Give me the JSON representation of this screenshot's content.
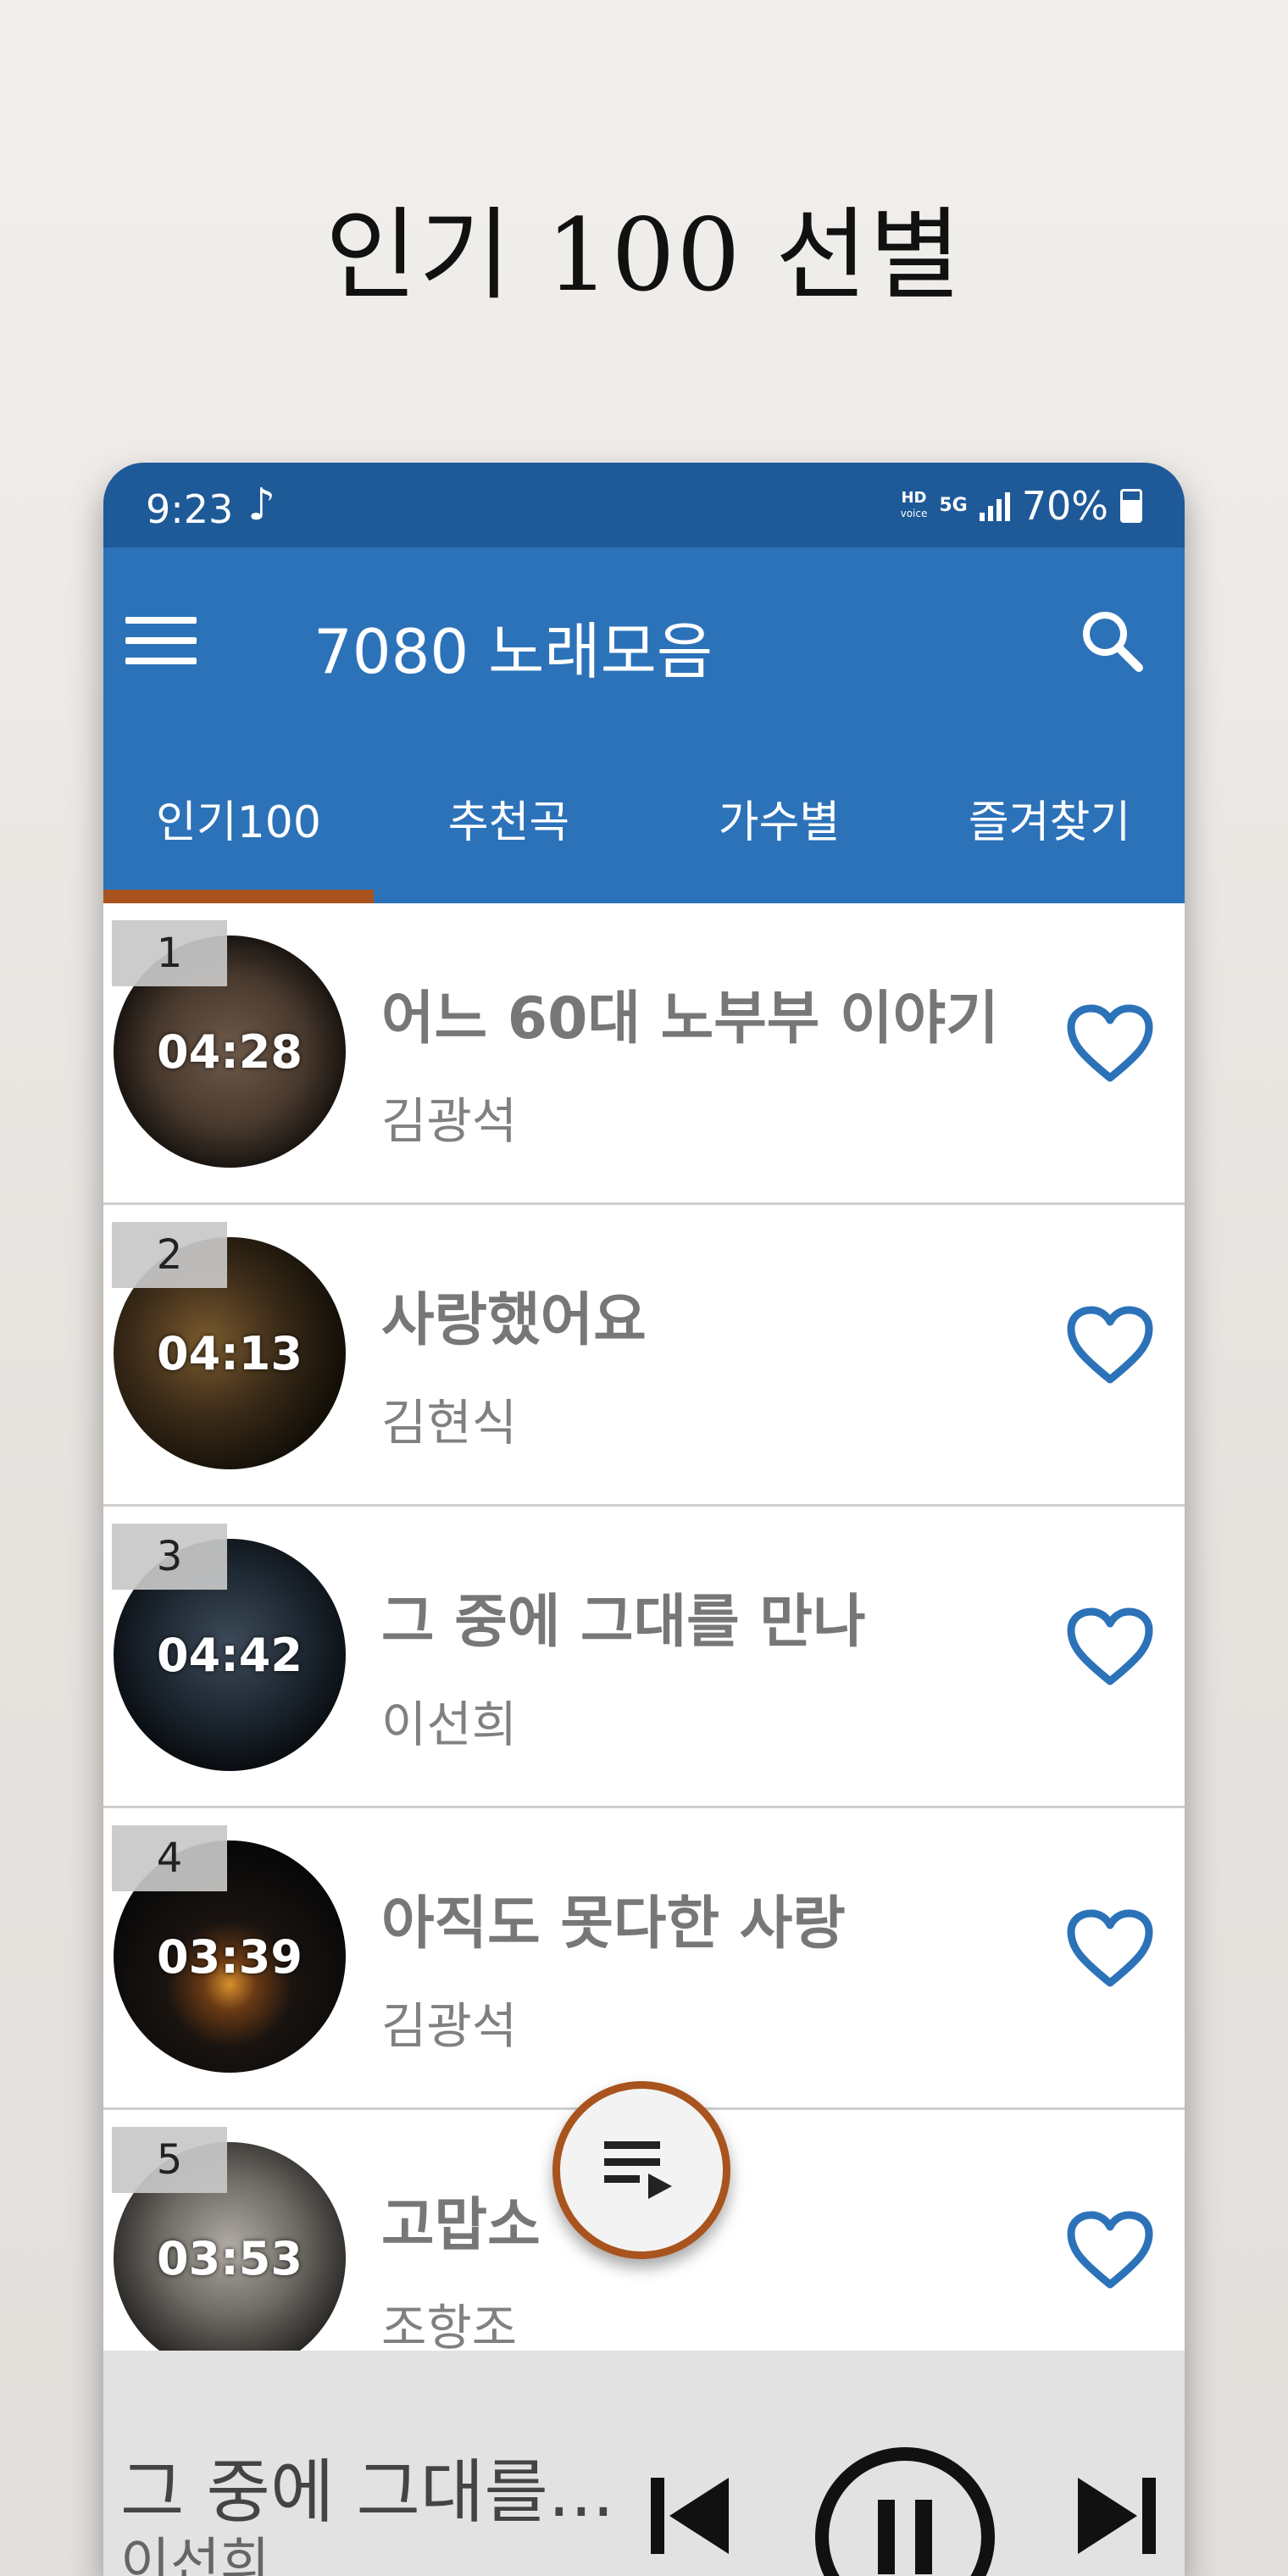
{
  "promo": {
    "headline": "인기 100 선별"
  },
  "status_bar": {
    "time": "9:23",
    "battery": "70%",
    "hd": "HD",
    "voice": "voice",
    "network": "5G"
  },
  "app_bar": {
    "title": "7080 노래모음"
  },
  "tabs": [
    {
      "label": "인기100",
      "active": true
    },
    {
      "label": "추천곡",
      "active": false
    },
    {
      "label": "가수별",
      "active": false
    },
    {
      "label": "즐겨찾기",
      "active": false
    }
  ],
  "songs": [
    {
      "rank": "1",
      "title": "어느 60대 노부부 이야기",
      "artist": "김광석",
      "duration": "04:28",
      "favorite": false
    },
    {
      "rank": "2",
      "title": "사랑했어요",
      "artist": "김현식",
      "duration": "04:13",
      "favorite": false
    },
    {
      "rank": "3",
      "title": "그 중에 그대를 만나",
      "artist": "이선희",
      "duration": "04:42",
      "favorite": false
    },
    {
      "rank": "4",
      "title": "아직도 못다한 사랑",
      "artist": "김광석",
      "duration": "03:39",
      "favorite": false
    },
    {
      "rank": "5",
      "title": "고맙소",
      "artist": "조항조",
      "duration": "03:53",
      "favorite": false
    }
  ],
  "now_playing": {
    "title": "그 중에 그대를...",
    "artist": "이선희",
    "state": "playing"
  },
  "colors": {
    "status_bar": "#1e5a98",
    "app_bar": "#2c72b9",
    "accent": "#a9541e",
    "heart": "#2c72b9"
  },
  "icons": [
    "menu-icon",
    "search-icon",
    "music-note-icon",
    "heart-outline-icon",
    "playlist-icon",
    "previous-icon",
    "pause-icon",
    "next-icon"
  ]
}
